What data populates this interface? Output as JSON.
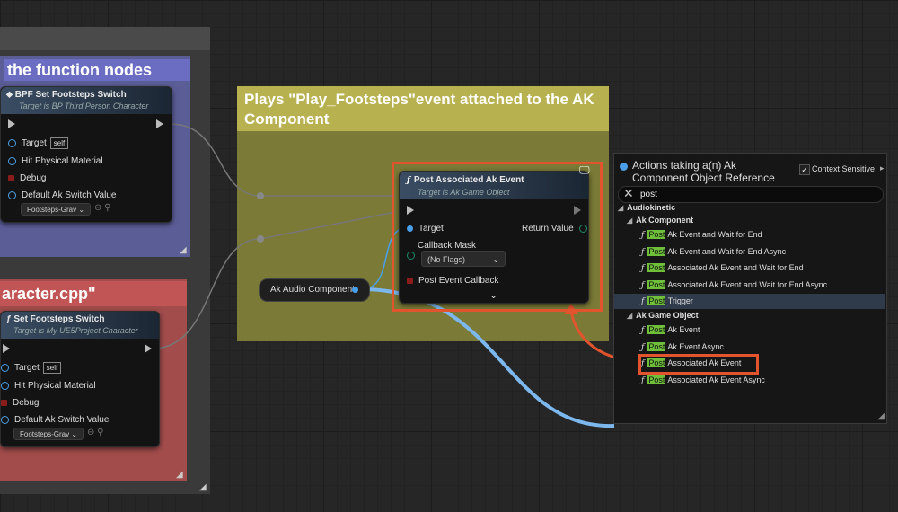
{
  "left_comments": {
    "top_title": "the function nodes",
    "bottom_title": "aracter.cpp\""
  },
  "node_bp_set": {
    "title": "BPF Set Footsteps Switch",
    "subtitle": "Target is BP Third Person Character",
    "pins": [
      "Target",
      "Hit Physical Material",
      "Debug",
      "Default Ak Switch Value"
    ],
    "target_badge": "self",
    "combo_value": "Footsteps-Grav"
  },
  "node_set": {
    "title": "Set Footsteps Switch",
    "subtitle": "Target is My UE5Project Character",
    "pins": [
      "Target",
      "Hit Physical Material",
      "Debug",
      "Default Ak Switch Value"
    ],
    "target_badge": "self",
    "combo_value": "Footsteps-Grav"
  },
  "yellow_comment": {
    "title": "Plays \"Play_Footsteps\"event attached to the AK Component"
  },
  "post_node": {
    "title": "Post Associated Ak Event",
    "subtitle": "Target is Ak Game Object",
    "target": "Target",
    "return_value": "Return Value",
    "callback_mask": "Callback Mask",
    "callback_mask_value": "(No Flags)",
    "post_event_callback": "Post Event Callback",
    "expand_icon": "chevron-down-icon"
  },
  "variable_node": {
    "label": "Ak Audio Component"
  },
  "context_menu": {
    "heading": "Actions taking a(n) Ak Component Object Reference",
    "context_sensitive": "Context Sensitive",
    "search_value": "post",
    "category": "Audiokinetic",
    "groups": [
      {
        "name": "Ak Component",
        "items": [
          {
            "hl": "Post",
            "rest": " Ak Event and Wait for End"
          },
          {
            "hl": "Post",
            "rest": " Ak Event and Wait for End Async"
          },
          {
            "hl": "Post",
            "rest": " Associated Ak Event and Wait for End"
          },
          {
            "hl": "Post",
            "rest": " Associated Ak Event and Wait for End Async"
          },
          {
            "hl": "Post",
            "rest": " Trigger"
          }
        ]
      },
      {
        "name": "Ak Game Object",
        "items": [
          {
            "hl": "Post",
            "rest": " Ak Event"
          },
          {
            "hl": "Post",
            "rest": " Ak Event Async"
          },
          {
            "hl": "Post",
            "rest": " Associated Ak Event"
          },
          {
            "hl": "Post",
            "rest": " Associated Ak Event Async"
          }
        ]
      }
    ]
  },
  "colors": {
    "annotation": "#e2542d",
    "wire_blue": "#7cb8ee",
    "highlight": "#6fbf3b"
  }
}
